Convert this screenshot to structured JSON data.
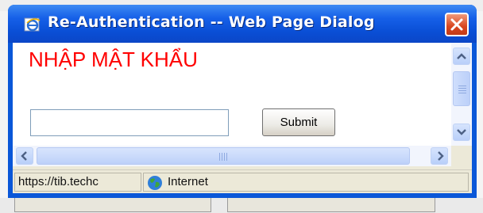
{
  "dialog": {
    "title": "Re-Authentication -- Web Page Dialog"
  },
  "content": {
    "heading": "NHẬP MẬT KHẨU",
    "password_value": "",
    "submit_label": "Submit"
  },
  "statusbar": {
    "url": "https://tib.techc",
    "zone": "Internet"
  },
  "colors": {
    "heading": "#ff0000",
    "titlebar": "#0a57d8",
    "close_button": "#d9461f"
  }
}
